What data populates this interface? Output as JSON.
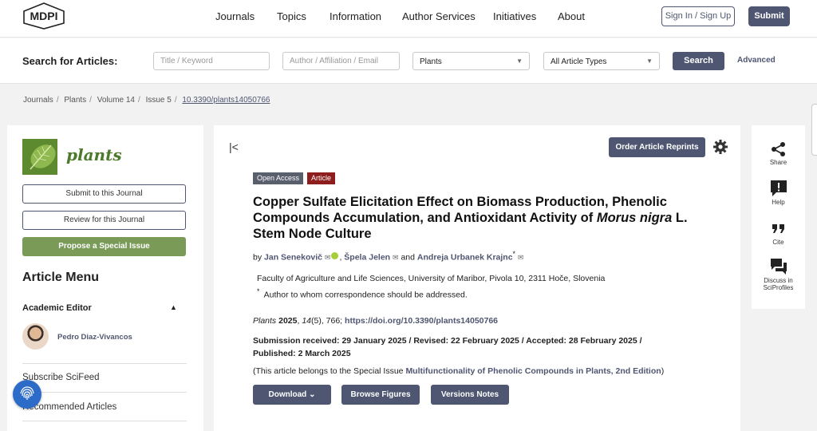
{
  "header": {
    "logo_text": "MDPI",
    "nav": [
      "Journals",
      "Topics",
      "Information",
      "Author Services",
      "Initiatives",
      "About"
    ],
    "signin_label": "Sign In / Sign Up",
    "submit_label": "Submit"
  },
  "search": {
    "title": "Search for Articles:",
    "title_placeholder": "Title / Keyword",
    "author_placeholder": "Author / Affiliation / Email",
    "journal_selected": "Plants",
    "type_selected": "All Article Types",
    "search_label": "Search",
    "advanced_label": "Advanced"
  },
  "breadcrumb": [
    "Journals",
    "Plants",
    "Volume 14",
    "Issue 5",
    "10.3390/plants14050766"
  ],
  "sidebar": {
    "journal_name": "plants",
    "submit_label": "Submit to this Journal",
    "review_label": "Review for this Journal",
    "propose_label": "Propose a Special Issue",
    "menu_title": "Article Menu",
    "editor_heading": "Academic Editor",
    "editor_name": "Pedro Diaz-Vivancos",
    "items": [
      "Subscribe SciFeed",
      "Recommended Articles"
    ]
  },
  "article": {
    "reprints_label": "Order Article Reprints",
    "tag_open": "Open Access",
    "tag_type": "Article",
    "title_part1": "Copper Sulfate Elicitation Effect on Biomass Production, Phenolic Compounds Accumulation, and Antioxidant Activity of ",
    "title_italic": "Morus nigra",
    "title_part2": " L. Stem Node Culture",
    "by": "by",
    "author1": "Jan Senekovič",
    "author2": "Špela Jelen",
    "and": "and",
    "author3": "Andreja Urbanek Krajnc",
    "affiliation": "Faculty of Agriculture and Life Sciences, University of Maribor, Pivola 10, 2311 Hoče, Slovenia",
    "correspondence": "Author to whom correspondence should be addressed.",
    "journal": "Plants",
    "year": "2025",
    "volume": "14",
    "issue_pages": "(5), 766;",
    "doi": "https://doi.org/10.3390/plants14050766",
    "dates": "Submission received: 29 January 2025 / Revised: 22 February 2025 / Accepted: 28 February 2025 / Published: 2 March 2025",
    "special_prefix": "(This article belongs to the Special Issue ",
    "special_name": "Multifunctionality of Phenolic Compounds in Plants, 2nd Edition",
    "special_suffix": ")",
    "download_label": "Download",
    "figures_label": "Browse Figures",
    "versions_label": "Versions Notes"
  },
  "rightbar": [
    "Share",
    "Help",
    "Cite",
    "Discuss in SciProfiles"
  ],
  "colors": {
    "primary": "#4f5671",
    "green": "#7a9a58",
    "article_tag": "#8e1d1d"
  }
}
